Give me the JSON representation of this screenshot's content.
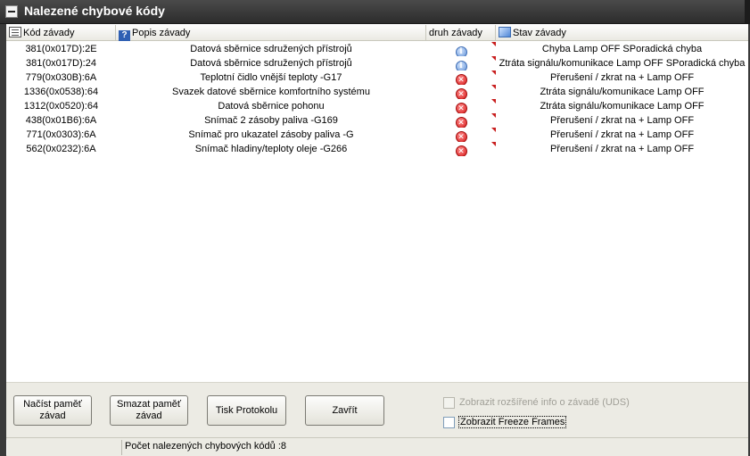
{
  "window": {
    "title": "Nalezené chybové kódy"
  },
  "columns": {
    "code": "Kód závady",
    "description": "Popis závady",
    "type": "druh závady",
    "state": "Stav závady"
  },
  "rows": [
    {
      "code": "381(0x017D):2E",
      "description": "Datová sběrnice sdružených přístrojů",
      "type_icon": "info-icon",
      "state": "Chyba Lamp OFF SPoradická chyba"
    },
    {
      "code": "381(0x017D):24",
      "description": "Datová sběrnice sdružených přístrojů",
      "type_icon": "info-icon",
      "state": "Ztráta signálu/komunikace Lamp OFF SPoradická chyba"
    },
    {
      "code": "779(0x030B):6A",
      "description": "Teplotní čidlo vnější teploty -G17",
      "type_icon": "error-icon",
      "state": "Přerušení / zkrat na + Lamp OFF"
    },
    {
      "code": "1336(0x0538):64",
      "description": "Svazek datové sběrnice komfortního systému",
      "type_icon": "error-icon",
      "state": "Ztráta signálu/komunikace Lamp OFF"
    },
    {
      "code": "1312(0x0520):64",
      "description": "Datová sběrnice pohonu",
      "type_icon": "error-icon",
      "state": "Ztráta signálu/komunikace Lamp OFF"
    },
    {
      "code": "438(0x01B6):6A",
      "description": "Snímač 2 zásoby paliva -G169",
      "type_icon": "error-icon",
      "state": "Přerušení / zkrat na + Lamp OFF"
    },
    {
      "code": "771(0x0303):6A",
      "description": "Snímač pro ukazatel zásoby paliva -G",
      "type_icon": "error-icon",
      "state": "Přerušení / zkrat na + Lamp OFF"
    },
    {
      "code": "562(0x0232):6A",
      "description": "Snímač hladiny/teploty oleje -G266",
      "type_icon": "error-icon",
      "state": "Přerušení / zkrat na + Lamp OFF"
    }
  ],
  "buttons": {
    "read_memory": "Načíst paměť závad",
    "clear_memory": "Smazat paměť závad",
    "print_protocol": "Tisk Protokolu",
    "close": "Zavřít"
  },
  "checkboxes": {
    "extended_info": {
      "label": "Zobrazit rozšířené info o závadě (UDS)",
      "checked": false,
      "enabled": false
    },
    "freeze_frames": {
      "label": "Zobrazit Freeze Frames",
      "checked": false,
      "enabled": true
    }
  },
  "status": {
    "count_text": "Počet nalezených chybových kódů :8"
  },
  "colors": {
    "titlebar": "#2c2c2c",
    "panel": "#ecebe4",
    "error": "#d61818",
    "info": "#5d8ed4",
    "flag": "#c81e1e"
  }
}
